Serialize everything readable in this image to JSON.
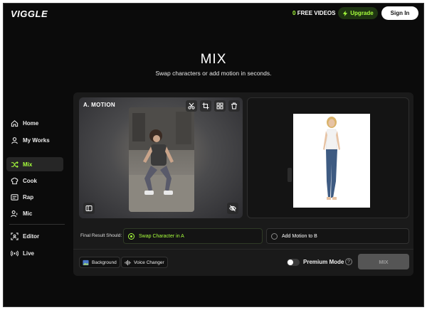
{
  "header": {
    "logo": "VIGGLE",
    "free_count": "0",
    "free_label": "FREE VIDEOS",
    "upgrade_label": "Upgrade",
    "signin_label": "Sign In"
  },
  "hero": {
    "title": "MIX",
    "subtitle": "Swap characters or add motion in seconds."
  },
  "sidebar": {
    "items": [
      {
        "label": "Home",
        "icon": "home-icon"
      },
      {
        "label": "My Works",
        "icon": "user-icon"
      },
      {
        "label": "Mix",
        "icon": "shuffle-icon",
        "active": true
      },
      {
        "label": "Cook",
        "icon": "chef-hat-icon"
      },
      {
        "label": "Rap",
        "icon": "microphone-box-icon"
      },
      {
        "label": "Mic",
        "icon": "user-mic-icon"
      },
      {
        "label": "Editor",
        "icon": "editor-icon"
      },
      {
        "label": "Live",
        "icon": "broadcast-icon"
      }
    ]
  },
  "motion": {
    "label": "A. MOTION",
    "tools": [
      "scissors-icon",
      "crop-icon",
      "grid-icon",
      "trash-icon"
    ]
  },
  "options": {
    "label": "Final Result Should:",
    "choices": [
      {
        "label": "Swap Character in A",
        "selected": true
      },
      {
        "label": "Add Motion to B",
        "selected": false
      }
    ]
  },
  "bottom": {
    "background_label": "Background",
    "voice_label": "Voice Changer",
    "premium_label": "Premium Mode",
    "help_symbol": "?",
    "mix_label": "MIX"
  },
  "colors": {
    "accent": "#a7ff3c",
    "background": "#0b0b0b",
    "panel": "#1a1a1a"
  }
}
